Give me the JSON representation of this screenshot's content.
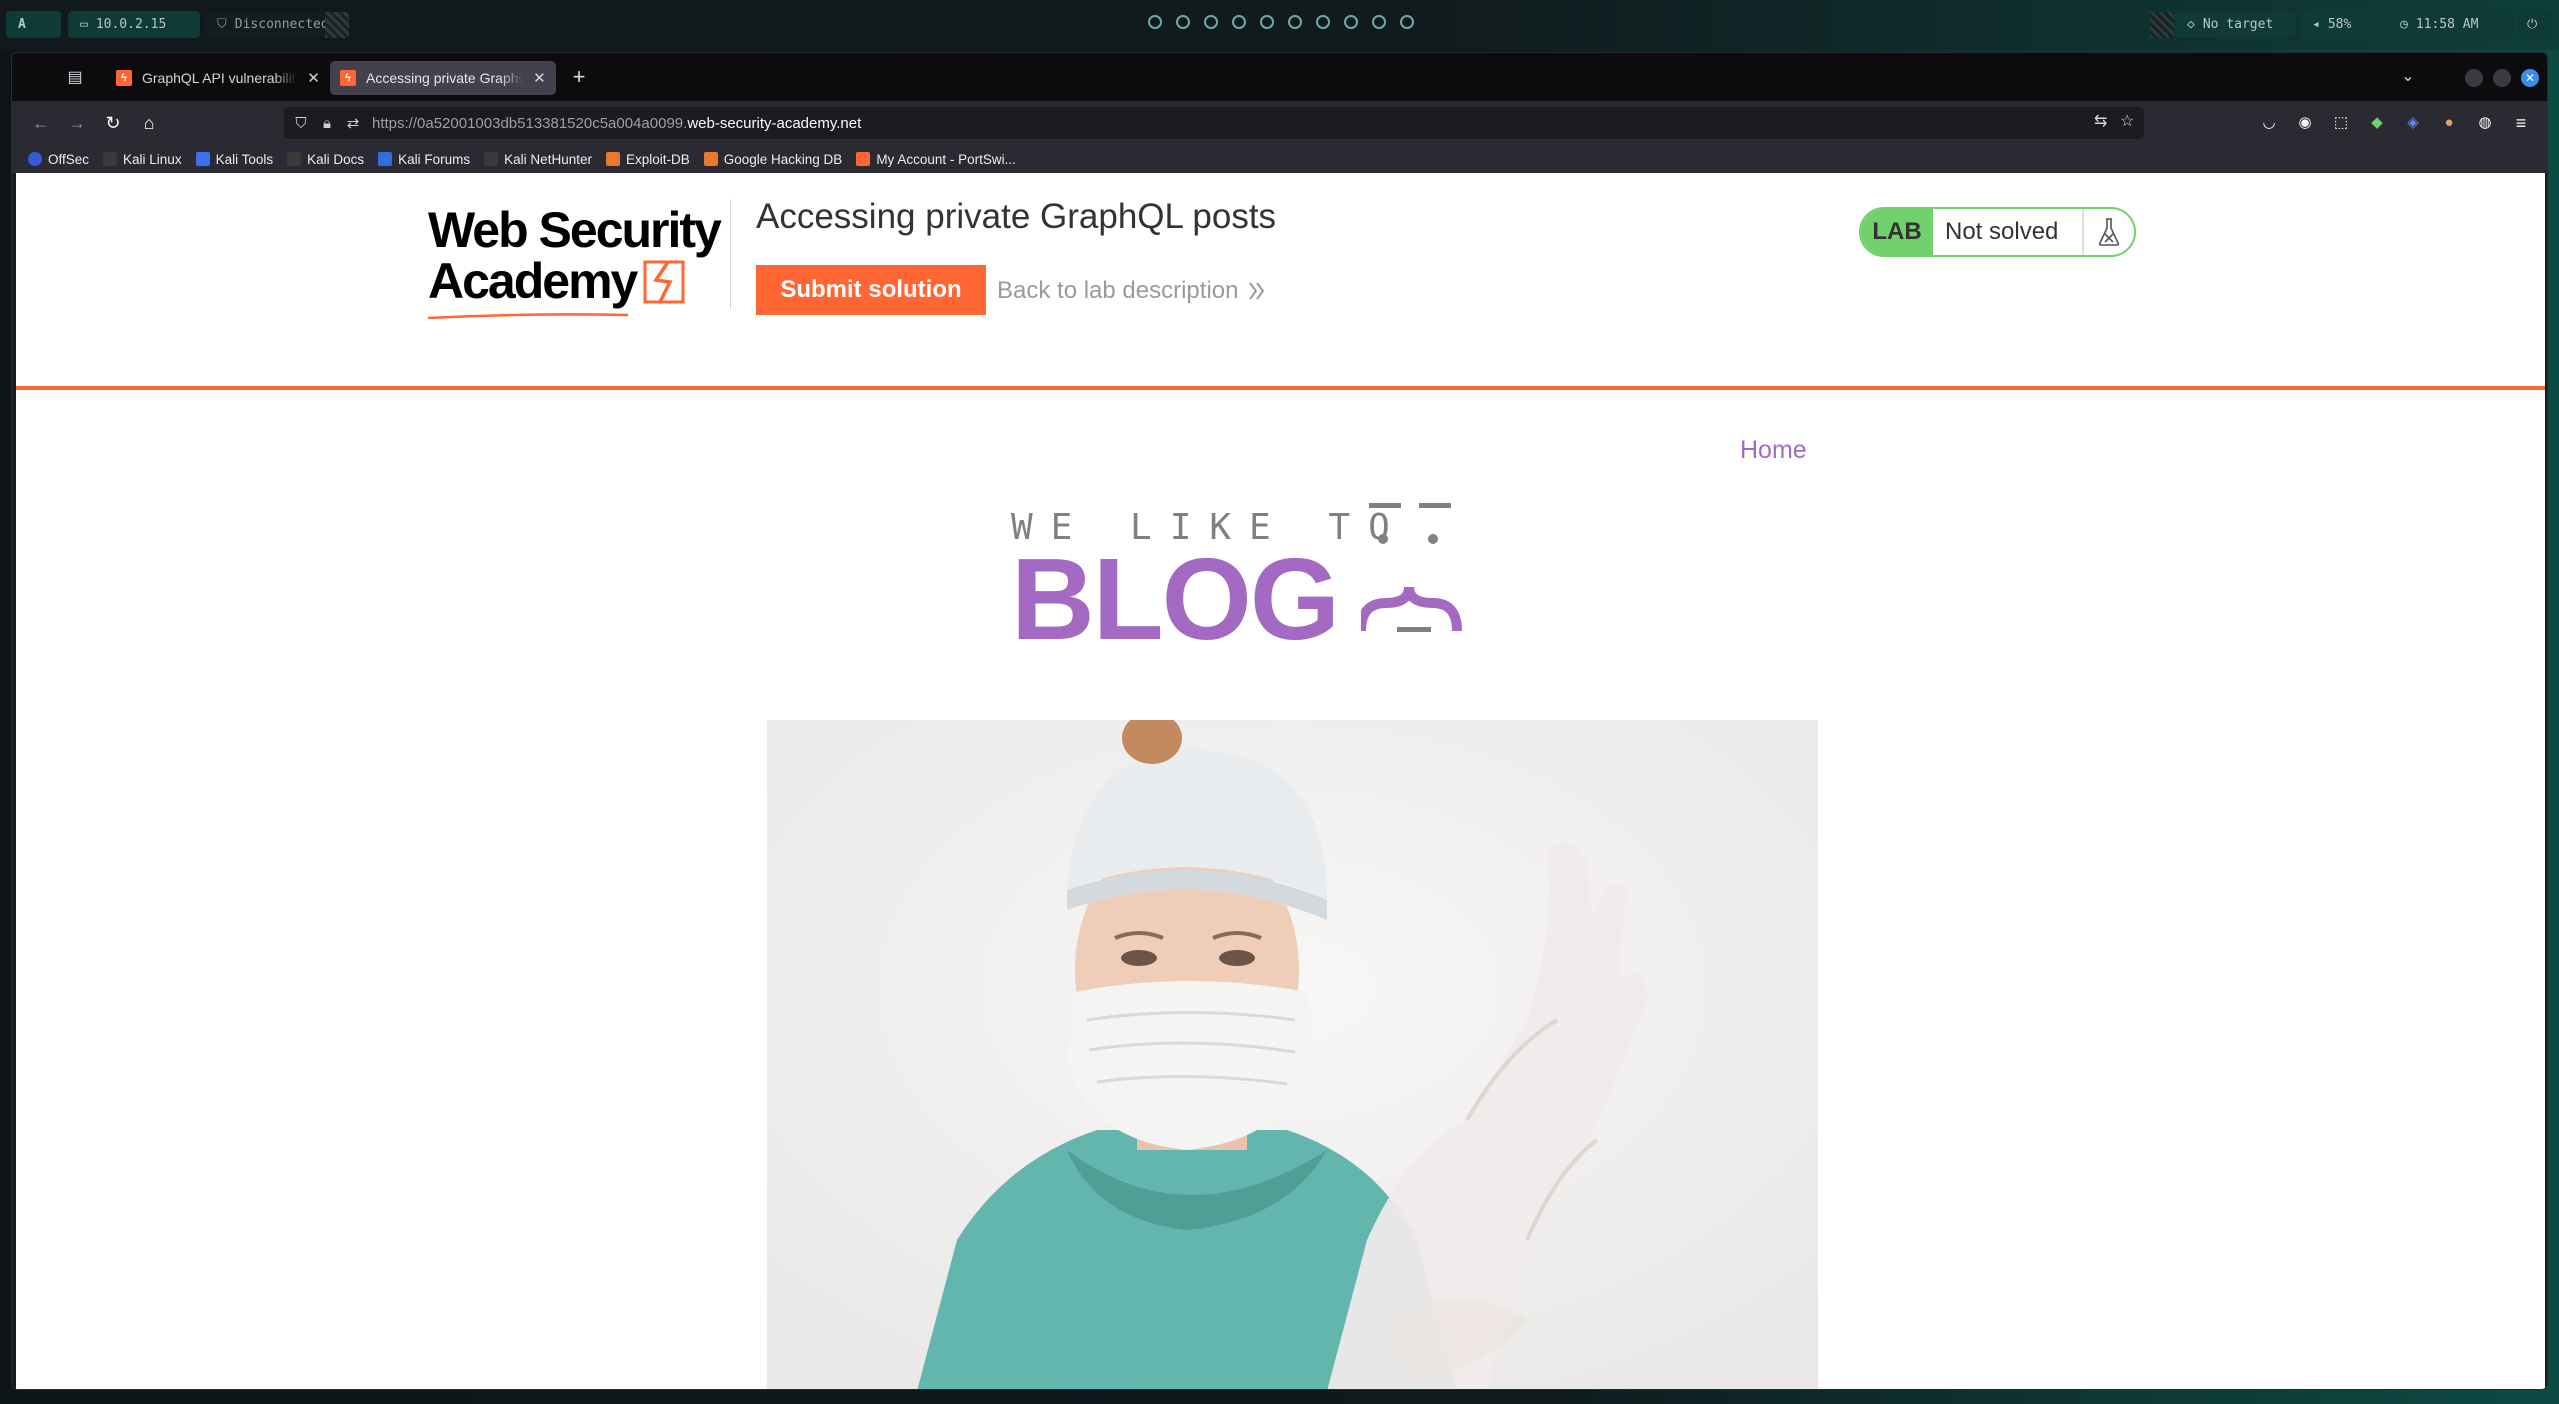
{
  "system_panel": {
    "ip": "10.0.2.15",
    "vpn_status": "Disconnected",
    "target": "No target",
    "volume": "58%",
    "clock": "11:58 AM"
  },
  "browser": {
    "tabs": [
      {
        "label": "GraphQL API vulnerabilities",
        "active": false
      },
      {
        "label": "Accessing private GraphQL posts",
        "active": true
      }
    ],
    "url_prefix": "https://0a52001003db513381520c5a004a0099.",
    "url_domain": "web-security-academy.net",
    "bookmarks": [
      "OffSec",
      "Kali Linux",
      "Kali Tools",
      "Kali Docs",
      "Kali Forums",
      "Kali NetHunter",
      "Exploit-DB",
      "Google Hacking DB",
      "My Account - PortSwi..."
    ]
  },
  "lab": {
    "logo_line1": "Web Security",
    "logo_line2": "Academy",
    "title": "Accessing private GraphQL posts",
    "submit_label": "Submit solution",
    "back_label": "Back to lab description",
    "status_tag": "LAB",
    "status_text": "Not solved",
    "accent": "#ff6633",
    "status_color": "#70d16d"
  },
  "blog": {
    "nav_home": "Home",
    "banner_top": "WE LIKE TO",
    "banner_main": "BLOG",
    "brand_color": "#a46ac3"
  }
}
